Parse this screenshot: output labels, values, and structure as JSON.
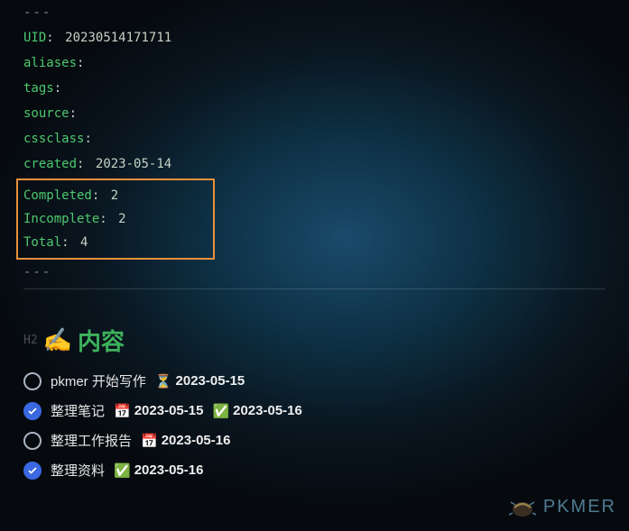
{
  "dashes": "---",
  "meta": {
    "uid_key": "UID",
    "uid_value": "20230514171711",
    "aliases_key": "aliases",
    "tags_key": "tags",
    "source_key": "source",
    "cssclass_key": "cssclass",
    "created_key": "created",
    "created_value": "2023-05-14"
  },
  "stats": {
    "completed_key": "Completed",
    "completed_value": "2",
    "incomplete_key": "Incomplete",
    "incomplete_value": "2",
    "total_key": "Total",
    "total_value": "4"
  },
  "heading": {
    "level": "H2",
    "emoji": "✍️",
    "text": "内容"
  },
  "tasks": [
    {
      "checked": false,
      "text": "pkmer 开始写作",
      "badges": [
        {
          "icon": "⏳",
          "date": "2023-05-15"
        }
      ]
    },
    {
      "checked": true,
      "text": "整理笔记",
      "badges": [
        {
          "icon": "📅",
          "date": "2023-05-15"
        },
        {
          "icon": "✅",
          "date": "2023-05-16"
        }
      ]
    },
    {
      "checked": false,
      "text": "整理工作报告",
      "badges": [
        {
          "icon": "📅",
          "date": "2023-05-16"
        }
      ]
    },
    {
      "checked": true,
      "text": "整理资料",
      "badges": [
        {
          "icon": "✅",
          "date": "2023-05-16"
        }
      ]
    }
  ],
  "watermark": "PKMER"
}
